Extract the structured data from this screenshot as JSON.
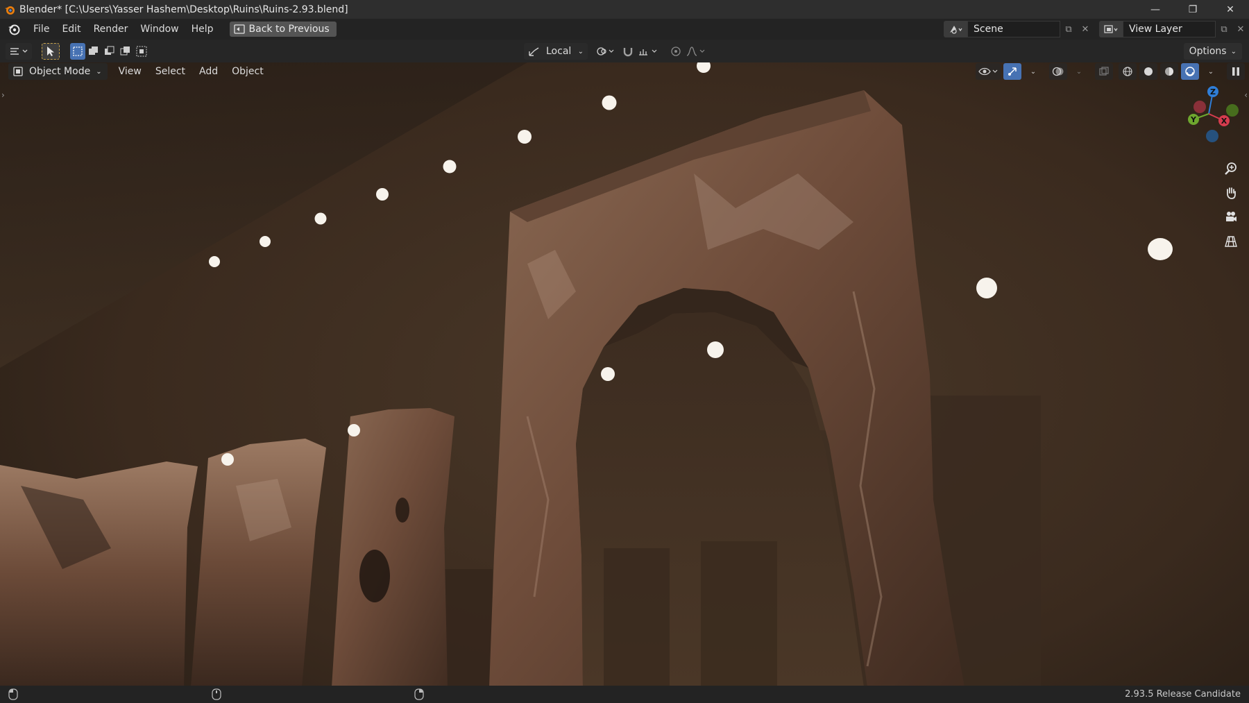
{
  "window": {
    "title": "Blender* [C:\\Users\\Yasser Hashem\\Desktop\\Ruins\\Ruins-2.93.blend]",
    "controls": [
      "minimize-icon",
      "restore-icon",
      "close-icon"
    ]
  },
  "menubar": {
    "items": [
      "File",
      "Edit",
      "Render",
      "Window",
      "Help"
    ],
    "back_button": "Back to Previous",
    "scene": "Scene",
    "view_layer": "View Layer"
  },
  "toolheader": {
    "pivot": "Local",
    "options": "Options"
  },
  "viewport": {
    "mode": "Object Mode",
    "menus": [
      "View",
      "Select",
      "Add",
      "Object"
    ],
    "gizmo_axes": [
      "Z",
      "Y",
      "X"
    ],
    "active_shading": "rendered"
  },
  "statusbar": {
    "version": "2.93.5 Release Candidate"
  },
  "colors": {
    "accent": "#4772b3",
    "axis_x": "#d63c4e",
    "axis_y": "#6ea62e",
    "axis_z": "#2f7ed8",
    "header_bg": "#232323"
  }
}
